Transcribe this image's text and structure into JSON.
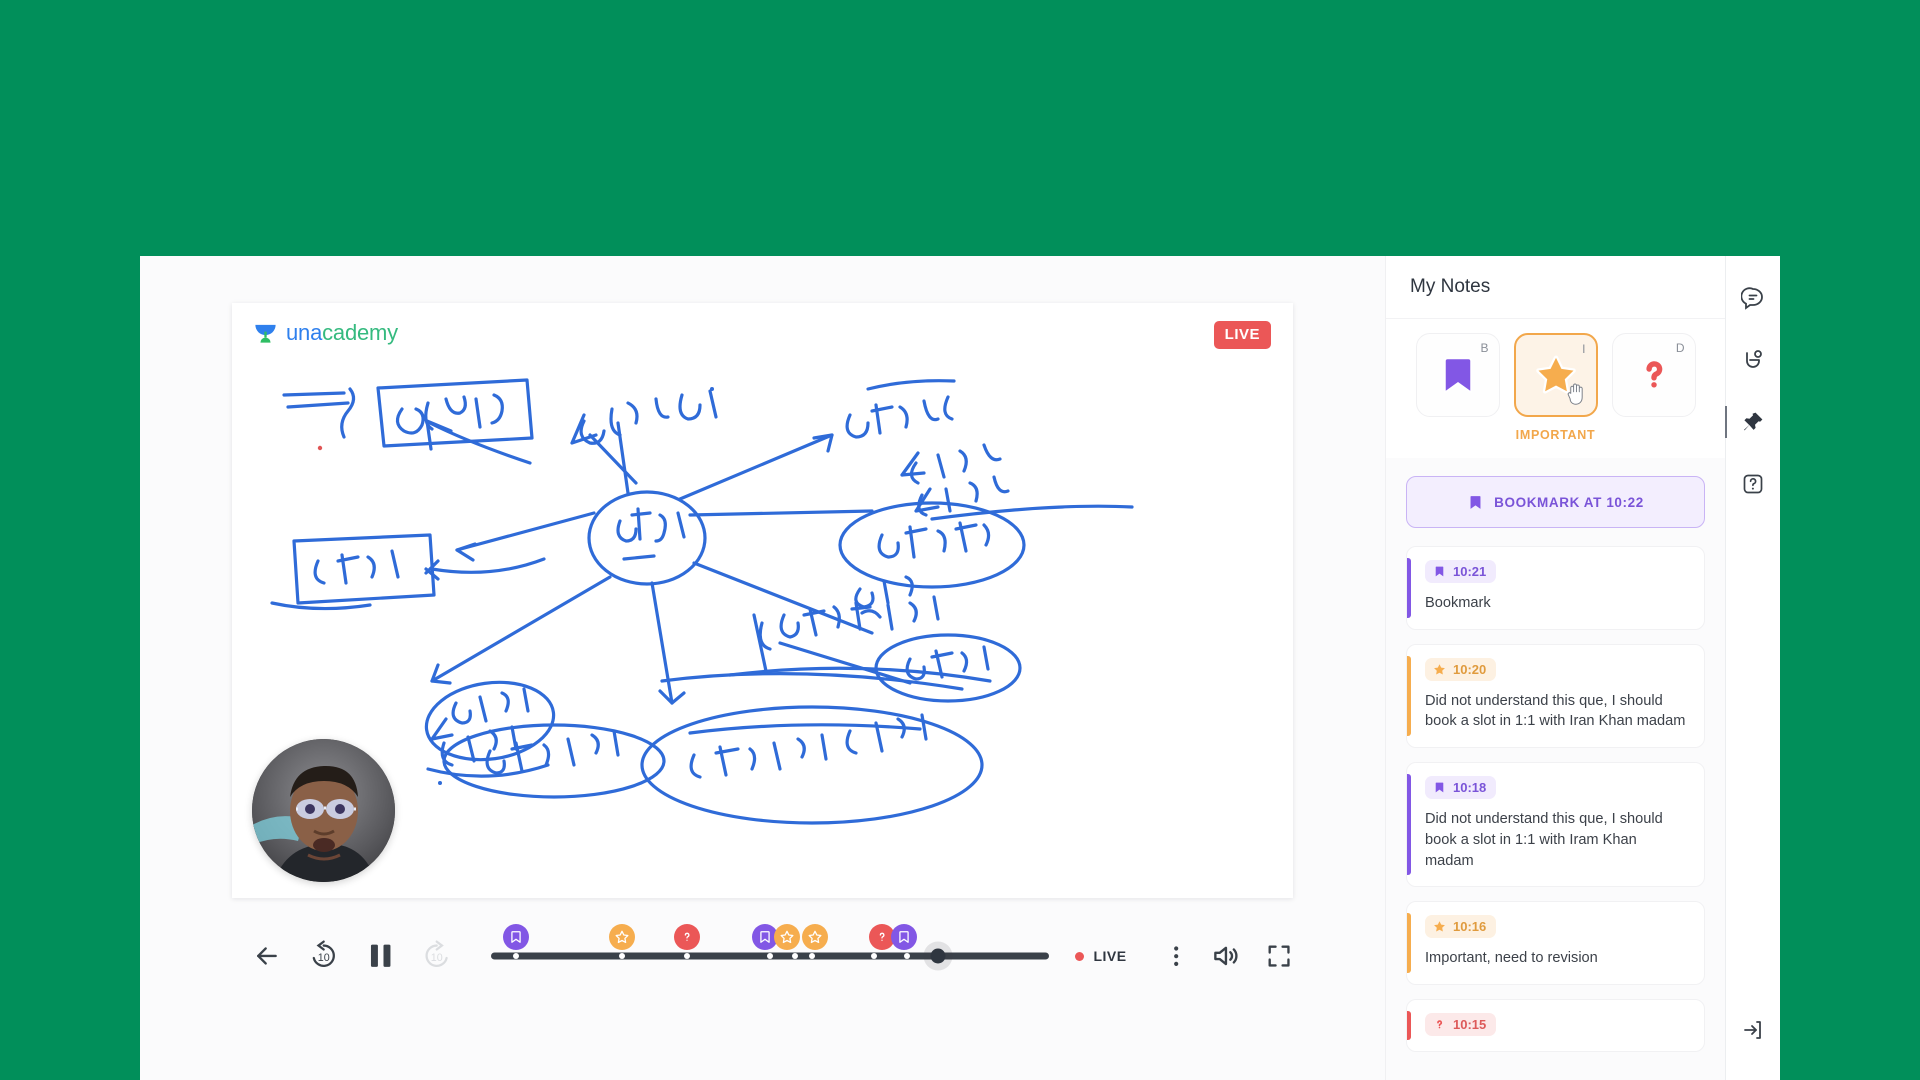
{
  "theme": {
    "page_background": "#018F5A",
    "accent_purple": "#8257E5",
    "accent_orange": "#F6AD4E",
    "accent_red": "#EB5757",
    "surface": "#ffffff"
  },
  "player": {
    "brand": {
      "name_part1": "una",
      "name_part2": "cademy",
      "logo_icon": "unacademy-bowl-logo"
    },
    "live_badge": "LIVE",
    "controls": {
      "back_label": "Back",
      "rewind_label": "10",
      "play_pause_label": "Pause",
      "forward_label": "10",
      "live_label": "LIVE",
      "more_label": "More options",
      "volume_label": "Volume",
      "fullscreen_label": "Fullscreen"
    },
    "timeline": {
      "progress_percent": 80,
      "dots_percent": [
        4.5,
        23.5,
        35,
        50,
        54.5,
        57.5,
        68.5,
        74.5,
        79.5
      ],
      "markers": [
        {
          "type": "bookmark",
          "position_percent": 4.5,
          "icon": "bookmark-icon"
        },
        {
          "type": "important",
          "position_percent": 23.5,
          "icon": "star-icon"
        },
        {
          "type": "doubt",
          "position_percent": 35,
          "icon": "question-icon"
        },
        {
          "type": "bookmark",
          "position_percent": 49,
          "icon": "bookmark-icon"
        },
        {
          "type": "important",
          "position_percent": 53,
          "icon": "star-icon"
        },
        {
          "type": "important",
          "position_percent": 58,
          "icon": "star-icon"
        },
        {
          "type": "doubt",
          "position_percent": 70,
          "icon": "question-icon"
        },
        {
          "type": "bookmark",
          "position_percent": 74,
          "icon": "bookmark-icon"
        }
      ]
    },
    "webcam": {
      "label": "instructor-video"
    },
    "whiteboard": {
      "label": "handwritten-gujarati-mind-map"
    }
  },
  "notes": {
    "title": "My Notes",
    "type_picker": {
      "caption": "IMPORTANT",
      "options": [
        {
          "id": "bookmark",
          "shortcut": "B",
          "icon": "bookmark-icon",
          "selected": false
        },
        {
          "id": "important",
          "shortcut": "I",
          "icon": "star-icon",
          "selected": true
        },
        {
          "id": "doubt",
          "shortcut": "D",
          "icon": "question-icon",
          "selected": false
        }
      ]
    },
    "bookmark_cta": {
      "label": "BOOKMARK AT 10:22",
      "icon": "bookmark-icon"
    },
    "items": [
      {
        "type": "bookmark",
        "time": "10:21",
        "text": "Bookmark"
      },
      {
        "type": "important",
        "time": "10:20",
        "text": "Did not understand this que, I should book a slot in 1:1 with Iran Khan madam"
      },
      {
        "type": "bookmark",
        "time": "10:18",
        "text": "Did not understand this que, I should book a slot in 1:1 with Iram Khan madam"
      },
      {
        "type": "important",
        "time": "10:16",
        "text": "Important, need to revision"
      },
      {
        "type": "doubt",
        "time": "10:15",
        "text": ""
      }
    ]
  },
  "right_rail": {
    "buttons": [
      {
        "id": "chat",
        "icon": "chat-icon",
        "active": false
      },
      {
        "id": "raise-hand",
        "icon": "raise-hand-icon",
        "active": false
      },
      {
        "id": "notes",
        "icon": "pin-icon",
        "active": true
      },
      {
        "id": "help",
        "icon": "help-icon",
        "active": false
      },
      {
        "id": "exit",
        "icon": "exit-icon",
        "active": false
      }
    ]
  }
}
